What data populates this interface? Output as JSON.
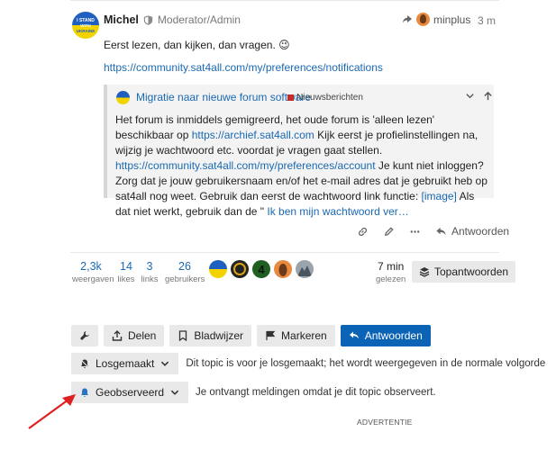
{
  "post": {
    "author": "Michel",
    "role": "Moderator/Admin",
    "reply_to_user": "minplus",
    "time": "3 m",
    "text": "Eerst lezen, dan kijken, dan vragen. 😉",
    "link": "https://community.sat4all.com/my/preferences/notifications",
    "avatar_alt": "I STAND WITH UKRAINE"
  },
  "quote": {
    "title": "Migratie naar nieuwe forum software",
    "category": "Nieuwsberichten",
    "text_1": "Het forum is inmiddels gemigreerd, het oude forum is 'alleen lezen' beschikbaar op ",
    "link_1": "https://archief.sat4all.com",
    "text_2": " Kijk eerst je profielinstellingen na, wijzig je wachtwoord etc. voordat je vragen gaat stellen. ",
    "link_2": "https://community.sat4all.com/my/preferences/account",
    "text_3": " Je kunt niet inloggen? Zorg dat je jouw gebruikersnaam en/of het e-mail adres dat je gebruikt heb op sat4all nog weet. Gebruik dan eerst de wachtwoord link functie: ",
    "link_3": "[image]",
    "text_4": " Als dat niet werkt, gebruik dan de \" ",
    "link_4": "Ik ben mijn wachtwoord ver…"
  },
  "actions": {
    "reply_label": "Antwoorden"
  },
  "stats": {
    "views_num": "2,3k",
    "views_label": "weergaven",
    "likes_num": "14",
    "likes_label": "likes",
    "links_num": "3",
    "links_label": "links",
    "users_num": "26",
    "users_label": "gebruikers",
    "read_num": "7 min",
    "read_label": "gelezen",
    "top_answers_label": "Topantwoorden"
  },
  "footer": {
    "share_label": "Delen",
    "bookmark_label": "Bladwijzer",
    "flag_label": "Markeren",
    "reply_label": "Antwoorden"
  },
  "notifications": {
    "level_1_label": "Losgemaakt",
    "level_1_desc": "Dit topic is voor je losgemaakt; het wordt weergegeven in de normale volgorde",
    "level_2_label": "Geobserveerd",
    "level_2_desc": "Je ontvangt meldingen omdat je dit topic observeert."
  },
  "advertisement_label": "ADVERTENTIE",
  "colors": {
    "link": "#1a69b3",
    "primary": "#0a63b5",
    "button_bg": "#e9e9e9",
    "arrow": "#e02020"
  }
}
